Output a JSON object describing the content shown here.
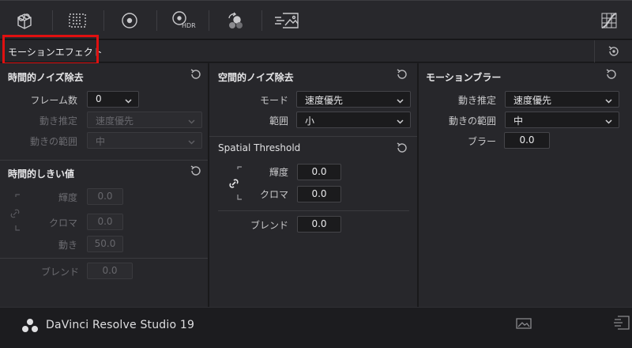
{
  "toolbar": {
    "icons": [
      "camera-track-icon",
      "grid-dots-icon",
      "circle-target-icon",
      "hdr-icon",
      "color-dots-icon",
      "image-export-icon",
      "curves-grid-icon"
    ],
    "hdr_label": "HDR"
  },
  "section": {
    "title": "モーションエフェクト"
  },
  "temporal_nr": {
    "title": "時間的ノイズ除去",
    "frames_label": "フレーム数",
    "frames_value": "0",
    "motion_est_label": "動き推定",
    "motion_est_value": "速度優先",
    "motion_range_label": "動きの範囲",
    "motion_range_value": "中"
  },
  "temporal_threshold": {
    "title": "時間的しきい値",
    "luma_label": "輝度",
    "luma_value": "0.0",
    "chroma_label": "クロマ",
    "chroma_value": "0.0",
    "motion_label": "動き",
    "motion_value": "50.0",
    "blend_label": "ブレンド",
    "blend_value": "0.0"
  },
  "spatial_nr": {
    "title": "空間的ノイズ除去",
    "mode_label": "モード",
    "mode_value": "速度優先",
    "radius_label": "範囲",
    "radius_value": "小"
  },
  "spatial_threshold": {
    "title": "Spatial Threshold",
    "luma_label": "輝度",
    "luma_value": "0.0",
    "chroma_label": "クロマ",
    "chroma_value": "0.0",
    "blend_label": "ブレンド",
    "blend_value": "0.0"
  },
  "motion_blur": {
    "title": "モーションブラー",
    "motion_est_label": "動き推定",
    "motion_est_value": "速度優先",
    "motion_range_label": "動きの範囲",
    "motion_range_value": "中",
    "blur_label": "ブラー",
    "blur_value": "0.0"
  },
  "footer": {
    "app_name": "DaVinci Resolve Studio 19"
  },
  "colors": {
    "highlight": "#e01010",
    "panel": "#27272b",
    "background": "#1e1e21"
  }
}
